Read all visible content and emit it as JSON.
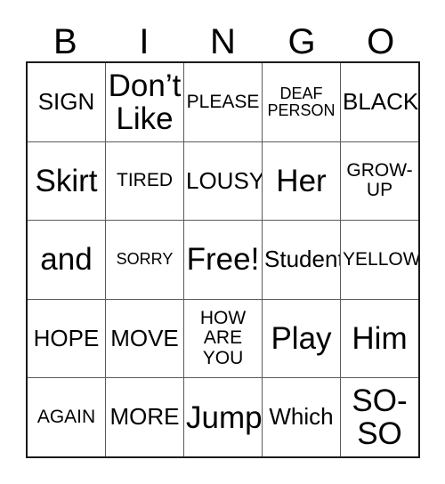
{
  "card": {
    "headers": [
      "B",
      "I",
      "N",
      "G",
      "O"
    ],
    "rows": [
      [
        {
          "text": "SIGN",
          "size": "md"
        },
        {
          "text": "Don’t\nLike",
          "size": "xl"
        },
        {
          "text": "PLEASE",
          "size": "sm"
        },
        {
          "text": "DEAF\nPERSON",
          "size": "xs"
        },
        {
          "text": "BLACK",
          "size": "md"
        }
      ],
      [
        {
          "text": "Skirt",
          "size": "xl"
        },
        {
          "text": "TIRED",
          "size": "sm"
        },
        {
          "text": "LOUSY",
          "size": "md"
        },
        {
          "text": "Her",
          "size": "xl"
        },
        {
          "text": "GROW-\nUP",
          "size": "sm"
        }
      ],
      [
        {
          "text": "and",
          "size": "xl"
        },
        {
          "text": "SORRY",
          "size": "xs"
        },
        {
          "text": "Free!",
          "size": "xl"
        },
        {
          "text": "Student",
          "size": "md"
        },
        {
          "text": "YELLOW",
          "size": "sm"
        }
      ],
      [
        {
          "text": "HOPE",
          "size": "md"
        },
        {
          "text": "MOVE",
          "size": "md"
        },
        {
          "text": "HOW\nARE\nYOU",
          "size": "sm"
        },
        {
          "text": "Play",
          "size": "xl"
        },
        {
          "text": "Him",
          "size": "xl"
        }
      ],
      [
        {
          "text": "AGAIN",
          "size": "sm"
        },
        {
          "text": "MORE",
          "size": "md"
        },
        {
          "text": "Jump",
          "size": "xl"
        },
        {
          "text": "Which",
          "size": "md"
        },
        {
          "text": "SO-\nSO",
          "size": "xl"
        }
      ]
    ]
  },
  "colors": {
    "outer_border": "#1a1a1a",
    "inner_border": "#5a5a5a",
    "text": "#000000",
    "background": "#ffffff"
  }
}
